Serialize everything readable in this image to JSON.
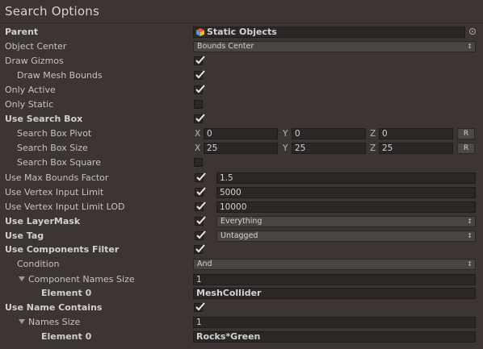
{
  "header": {
    "title": "Search Options"
  },
  "parent": {
    "label": "Parent",
    "value": "Static Objects"
  },
  "object_center": {
    "label": "Object Center",
    "value": "Bounds Center"
  },
  "draw_gizmos": {
    "label": "Draw Gizmos",
    "checked": true
  },
  "draw_mesh_bounds": {
    "label": "Draw Mesh Bounds",
    "checked": true
  },
  "only_active": {
    "label": "Only Active",
    "checked": true
  },
  "only_static": {
    "label": "Only Static",
    "checked": false
  },
  "use_search_box": {
    "label": "Use Search Box",
    "checked": true
  },
  "search_box_pivot": {
    "label": "Search Box Pivot",
    "x_label": "X",
    "x": "0",
    "y_label": "Y",
    "y": "0",
    "z_label": "Z",
    "z": "0",
    "reset": "R"
  },
  "search_box_size": {
    "label": "Search Box Size",
    "x_label": "X",
    "x": "25",
    "y_label": "Y",
    "y": "25",
    "z_label": "Z",
    "z": "25",
    "reset": "R"
  },
  "search_box_square": {
    "label": "Search Box Square",
    "checked": false
  },
  "use_max_bounds_factor": {
    "label": "Use Max Bounds Factor",
    "checked": true,
    "value": "1.5"
  },
  "use_vertex_input_limit": {
    "label": "Use Vertex Input Limit",
    "checked": true,
    "value": "5000"
  },
  "use_vertex_input_limit_lod": {
    "label": "Use Vertex Input Limit LOD",
    "checked": true,
    "value": "10000"
  },
  "use_layermask": {
    "label": "Use LayerMask",
    "checked": true,
    "value": "Everything"
  },
  "use_tag": {
    "label": "Use Tag",
    "checked": true,
    "value": "Untagged"
  },
  "use_components_filter": {
    "label": "Use Components Filter",
    "checked": true
  },
  "condition": {
    "label": "Condition",
    "value": "And"
  },
  "component_names_size": {
    "label": "Component Names Size",
    "value": "1"
  },
  "component_element_0": {
    "label": "Element 0",
    "value": "MeshCollider"
  },
  "use_name_contains": {
    "label": "Use Name Contains",
    "checked": true
  },
  "names_size": {
    "label": "Names Size",
    "value": "1"
  },
  "name_element_0": {
    "label": "Element 0",
    "value": "Rocks*Green"
  }
}
